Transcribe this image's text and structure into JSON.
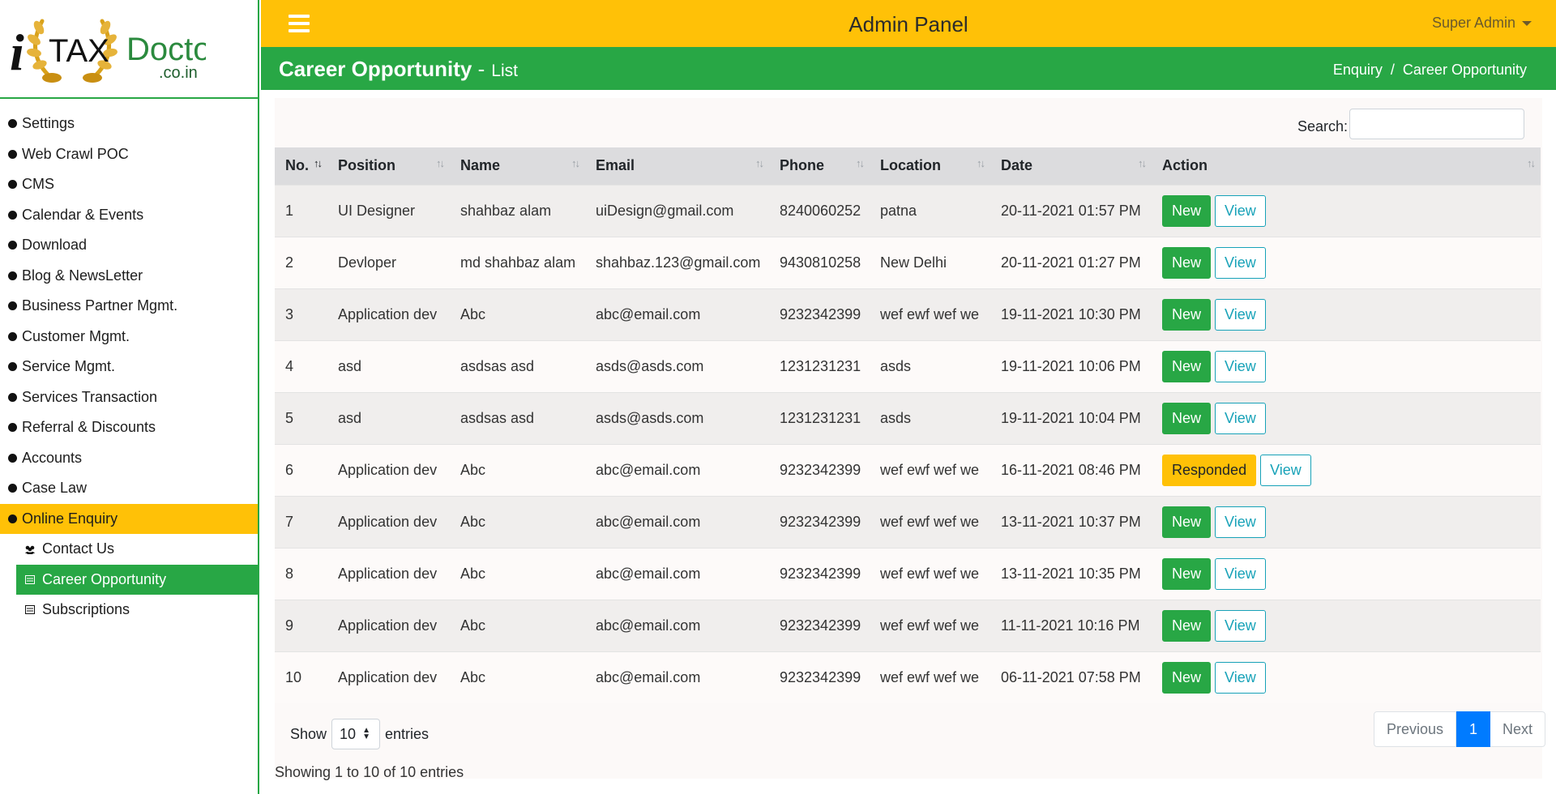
{
  "logo": {
    "letter": "i",
    "word1": "TAX",
    "word2": "Doctor",
    "domain": ".co.in"
  },
  "sidebar": {
    "items": [
      {
        "label": "Settings"
      },
      {
        "label": "Web Crawl POC"
      },
      {
        "label": "CMS"
      },
      {
        "label": "Calendar & Events"
      },
      {
        "label": "Download"
      },
      {
        "label": "Blog & NewsLetter"
      },
      {
        "label": "Business Partner Mgmt."
      },
      {
        "label": "Customer Mgmt."
      },
      {
        "label": "Service Mgmt."
      },
      {
        "label": "Services Transaction"
      },
      {
        "label": "Referral & Discounts"
      },
      {
        "label": "Accounts"
      },
      {
        "label": "Case Law"
      },
      {
        "label": "Online Enquiry",
        "active": true
      }
    ],
    "subitems": [
      {
        "label": "Contact Us",
        "icon": "users-icon"
      },
      {
        "label": "Career Opportunity",
        "icon": "list-icon",
        "active": true
      },
      {
        "label": "Subscriptions",
        "icon": "list-icon"
      }
    ]
  },
  "topbar": {
    "title": "Admin Panel",
    "user": "Super Admin"
  },
  "header": {
    "title": "Career Opportunity",
    "separator": "-",
    "subtitle": "List",
    "breadcrumb": [
      "Enquiry",
      "Career Opportunity"
    ],
    "breadcrumb_sep": "/"
  },
  "colors": {
    "yellow": "#ffc107",
    "green": "#28a745",
    "blue": "#007bff",
    "info": "#17a2b8"
  },
  "search": {
    "label": "Search:",
    "value": ""
  },
  "table": {
    "columns": [
      "No.",
      "Position",
      "Name",
      "Email",
      "Phone",
      "Location",
      "Date",
      "Action"
    ],
    "rows": [
      {
        "no": "1",
        "position": "UI Designer",
        "name": "shahbaz alam",
        "email": "uiDesign@gmail.com",
        "phone": "8240060252",
        "location": "patna",
        "date": "20-11-2021 01:57 PM",
        "status": "New",
        "view": "View"
      },
      {
        "no": "2",
        "position": "Devloper",
        "name": "md shahbaz alam",
        "email": "shahbaz.123@gmail.com",
        "phone": "9430810258",
        "location": "New Delhi",
        "date": "20-11-2021 01:27 PM",
        "status": "New",
        "view": "View"
      },
      {
        "no": "3",
        "position": "Application dev",
        "name": "Abc",
        "email": "abc@email.com",
        "phone": "9232342399",
        "location": "wef ewf wef we",
        "date": "19-11-2021 10:30 PM",
        "status": "New",
        "view": "View"
      },
      {
        "no": "4",
        "position": "asd",
        "name": "asdsas asd",
        "email": "asds@asds.com",
        "phone": "1231231231",
        "location": "asds",
        "date": "19-11-2021 10:06 PM",
        "status": "New",
        "view": "View"
      },
      {
        "no": "5",
        "position": "asd",
        "name": "asdsas asd",
        "email": "asds@asds.com",
        "phone": "1231231231",
        "location": "asds",
        "date": "19-11-2021 10:04 PM",
        "status": "New",
        "view": "View"
      },
      {
        "no": "6",
        "position": "Application dev",
        "name": "Abc",
        "email": "abc@email.com",
        "phone": "9232342399",
        "location": "wef ewf wef we",
        "date": "16-11-2021 08:46 PM",
        "status": "Responded",
        "view": "View"
      },
      {
        "no": "7",
        "position": "Application dev",
        "name": "Abc",
        "email": "abc@email.com",
        "phone": "9232342399",
        "location": "wef ewf wef we",
        "date": "13-11-2021 10:37 PM",
        "status": "New",
        "view": "View"
      },
      {
        "no": "8",
        "position": "Application dev",
        "name": "Abc",
        "email": "abc@email.com",
        "phone": "9232342399",
        "location": "wef ewf wef we",
        "date": "13-11-2021 10:35 PM",
        "status": "New",
        "view": "View"
      },
      {
        "no": "9",
        "position": "Application dev",
        "name": "Abc",
        "email": "abc@email.com",
        "phone": "9232342399",
        "location": "wef ewf wef we",
        "date": "11-11-2021 10:16 PM",
        "status": "New",
        "view": "View"
      },
      {
        "no": "10",
        "position": "Application dev",
        "name": "Abc",
        "email": "abc@email.com",
        "phone": "9232342399",
        "location": "wef ewf wef we",
        "date": "06-11-2021 07:58 PM",
        "status": "New",
        "view": "View"
      }
    ]
  },
  "length": {
    "show": "Show",
    "value": "10",
    "entries": "entries"
  },
  "info": "Showing 1 to 10 of 10 entries",
  "pagination": {
    "previous": "Previous",
    "current": "1",
    "next": "Next"
  }
}
